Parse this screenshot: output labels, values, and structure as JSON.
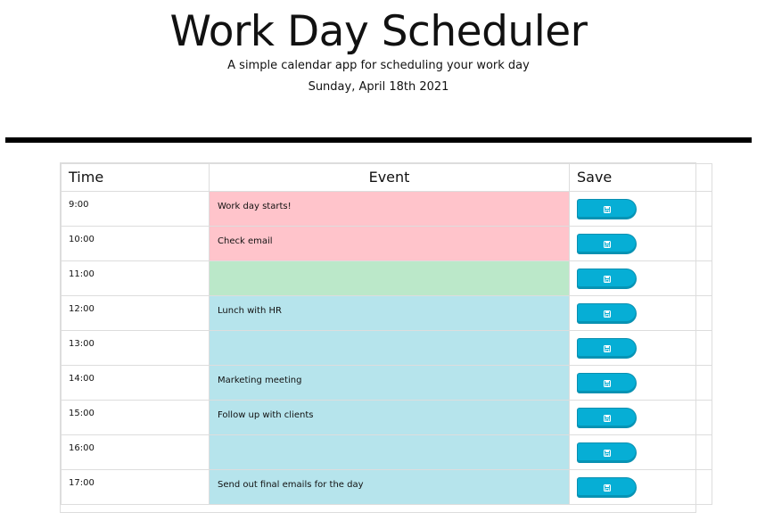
{
  "header": {
    "title": "Work Day Scheduler",
    "subtitle": "A simple calendar app for scheduling your work day",
    "date": "Sunday, April 18th 2021"
  },
  "table": {
    "headers": {
      "time": "Time",
      "event": "Event",
      "save": "Save"
    },
    "rows": [
      {
        "time": "9:00",
        "event": "Work day starts!",
        "status": "past"
      },
      {
        "time": "10:00",
        "event": "Check email",
        "status": "past"
      },
      {
        "time": "11:00",
        "event": "",
        "status": "present"
      },
      {
        "time": "12:00",
        "event": "Lunch with HR",
        "status": "future"
      },
      {
        "time": "13:00",
        "event": "",
        "status": "future"
      },
      {
        "time": "14:00",
        "event": "Marketing meeting",
        "status": "future"
      },
      {
        "time": "15:00",
        "event": "Follow up with clients",
        "status": "future"
      },
      {
        "time": "16:00",
        "event": "",
        "status": "future"
      },
      {
        "time": "17:00",
        "event": "Send out final emails for the day",
        "status": "future"
      }
    ]
  },
  "colors": {
    "past": "#ffc4cb",
    "present": "#bbe8c9",
    "future": "#b6e4ec",
    "save_button": "#06aed5",
    "divider": "#000000"
  },
  "icons": {
    "save": "save-icon"
  }
}
